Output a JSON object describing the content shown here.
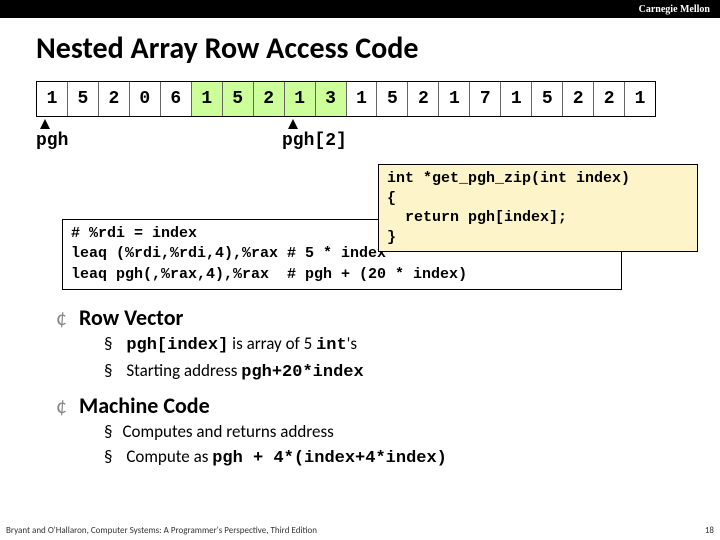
{
  "brand": "Carnegie Mellon",
  "title": "Nested Array Row Access Code",
  "array_cells": [
    "1",
    "5",
    "2",
    "0",
    "6",
    "1",
    "5",
    "2",
    "1",
    "3",
    "1",
    "5",
    "2",
    "1",
    "7",
    "1",
    "5",
    "2",
    "2",
    "1"
  ],
  "highlight_start": 5,
  "highlight_end": 9,
  "ptr1": "pgh",
  "ptr2": "pgh[2]",
  "code_c": "int *get_pgh_zip(int index)\n{\n  return pgh[index];\n}",
  "code_asm": "# %rdi = index\nleaq (%rdi,%rdi,4),%rax # 5 * index\nleaq pgh(,%rax,4),%rax  # pgh + (20 * index)",
  "section1": "Row Vector",
  "s1_b1a": "pgh[index]",
  "s1_b1b": " is array of 5 ",
  "s1_b1c": "int",
  "s1_b1d": "'s",
  "s1_b2a": "Starting address ",
  "s1_b2b": "pgh+20*index",
  "section2": "Machine Code",
  "s2_b1": "Computes and returns address",
  "s2_b2a": "Compute as ",
  "s2_b2b": "pgh + 4*(index+4*index)",
  "footer_left": "Bryant and O'Hallaron, Computer Systems: A Programmer's Perspective, Third Edition",
  "footer_right": "18"
}
